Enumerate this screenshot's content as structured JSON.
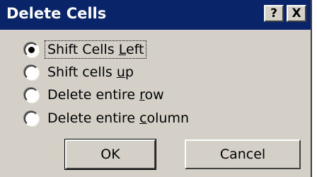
{
  "dialog": {
    "title": "Delete Cells",
    "help_button": "?",
    "close_button": "X"
  },
  "options": [
    {
      "label_pre": "Shift Cells ",
      "label_key": "L",
      "label_post": "eft",
      "checked": true
    },
    {
      "label_pre": "Shift cells ",
      "label_key": "u",
      "label_post": "p",
      "checked": false
    },
    {
      "label_pre": "Delete entire ",
      "label_key": "r",
      "label_post": "ow",
      "checked": false
    },
    {
      "label_pre": "Delete entire ",
      "label_key": "c",
      "label_post": "olumn",
      "checked": false
    }
  ],
  "buttons": {
    "ok": "OK",
    "cancel": "Cancel"
  },
  "colors": {
    "titlebar": "#0a246a",
    "face": "#d4d0c8"
  }
}
